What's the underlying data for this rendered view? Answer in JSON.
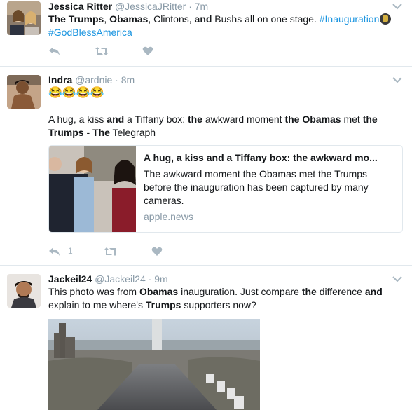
{
  "tweets": [
    {
      "name": "Jessica Ritter",
      "handle": "@JessicaJRitter",
      "time": "· 7m",
      "text": {
        "p1": "The Trumps",
        "p2": ", ",
        "p3": "Obamas",
        "p4": ", Clintons, ",
        "p5": "and",
        "p6": " Bushs all on one stage. ",
        "hashtag1": "#Inauguration",
        "hashtag2": "#GodBlessAmerica"
      }
    },
    {
      "name": "Indra",
      "handle": "@ardnie",
      "time": "· 8m",
      "emoji_line": "😂😂😂😂",
      "text": {
        "p1": "A hug, a kiss ",
        "p2": "and",
        "p3": " a Tiffany box: ",
        "p4": "the",
        "p5": " awkward moment ",
        "p6": "the Obamas",
        "p7": " met ",
        "p8": "the Trumps",
        "p9": " - ",
        "p10": "The",
        "p11": " Telegraph"
      },
      "card": {
        "title": "A hug, a kiss and a Tiffany box: the awkward mo...",
        "description": "The awkward moment the Obamas met the Trumps before the inauguration has been captured by many cameras.",
        "domain": "apple.news"
      },
      "reply_count": "1"
    },
    {
      "name": "Jackeil24",
      "handle": "@Jackeil24",
      "time": "· 9m",
      "text": {
        "p1": "This photo was from ",
        "p2": "Obamas",
        "p3": " inauguration. Just compare ",
        "p4": "the",
        "p5": " difference ",
        "p6": "and",
        "p7": " explain to me where's ",
        "p8": "Trumps",
        "p9": " supporters now?"
      }
    }
  ],
  "icons": {
    "reply": "reply-icon",
    "retweet": "retweet-icon",
    "like": "heart-icon",
    "caret": "chevron-down-icon"
  },
  "colors": {
    "link": "#1b95e0",
    "muted": "#8899a6",
    "action": "#aab8c2"
  }
}
